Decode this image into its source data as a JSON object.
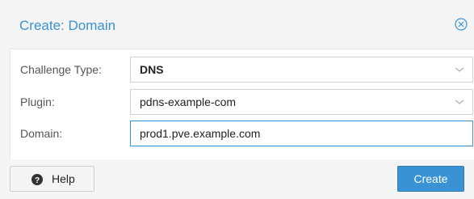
{
  "dialog": {
    "title": "Create: Domain",
    "close_icon": "close-circle-icon"
  },
  "form": {
    "challenge_type": {
      "label": "Challenge Type:",
      "value": "DNS"
    },
    "plugin": {
      "label": "Plugin:",
      "value": "pdns-example-com"
    },
    "domain": {
      "label": "Domain:",
      "value": "prod1.pve.example.com"
    }
  },
  "footer": {
    "help_label": "Help",
    "help_icon": "question-circle-icon",
    "create_label": "Create"
  },
  "colors": {
    "accent": "#3892d4",
    "background": "#f5f5f5"
  }
}
